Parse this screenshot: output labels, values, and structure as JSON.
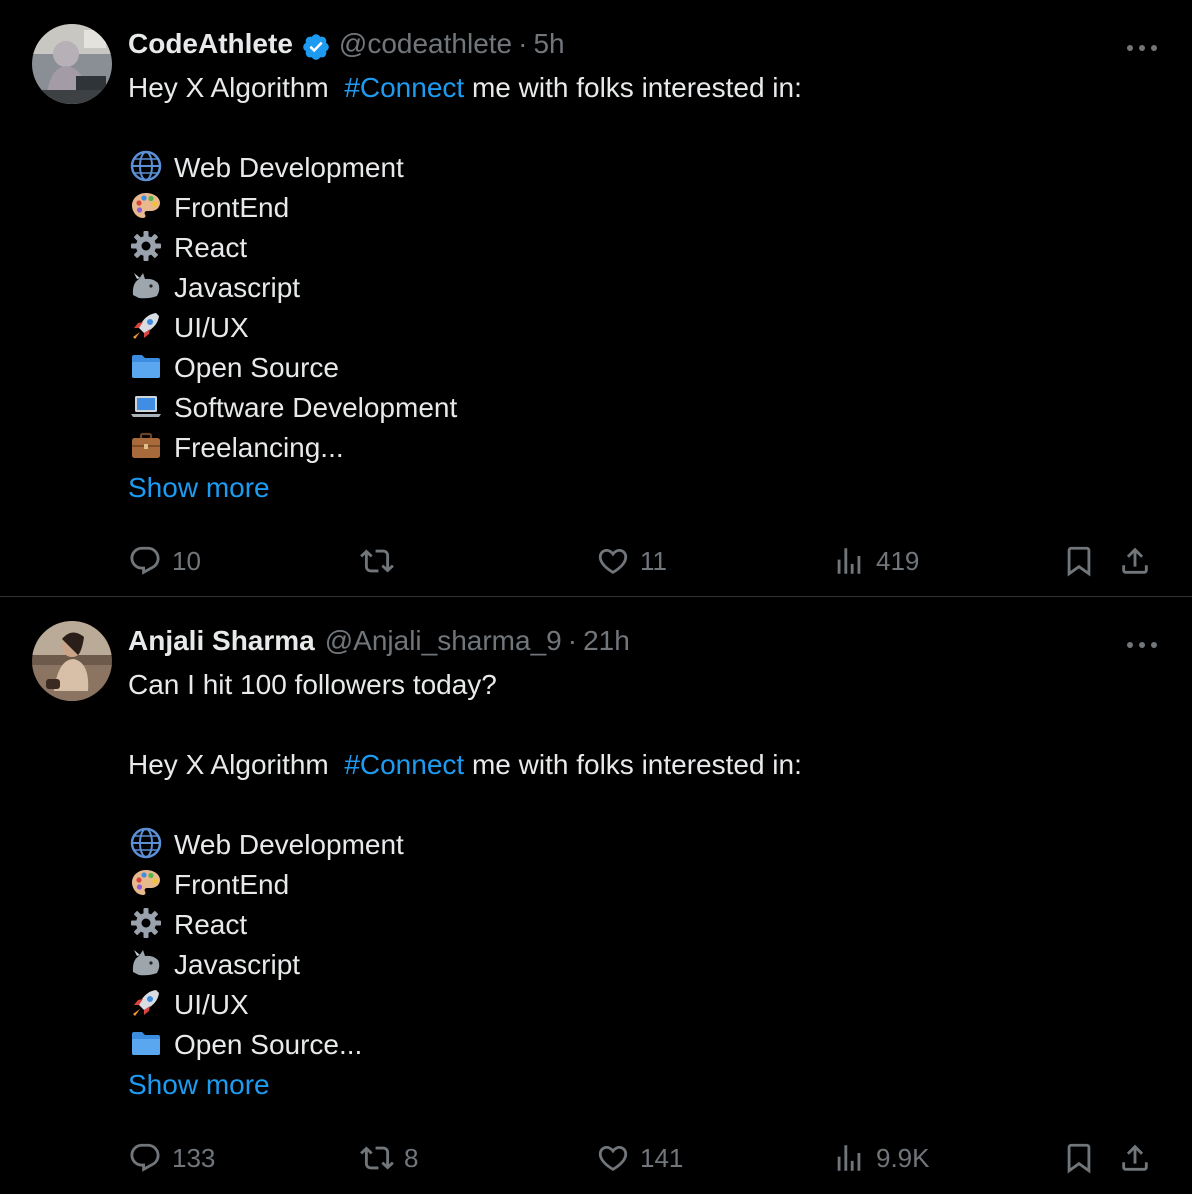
{
  "tweets": [
    {
      "name": "CodeAthlete",
      "handle": "@codeathlete",
      "separator": "·",
      "time": "5h",
      "verified": true,
      "lines": [
        {
          "type": "text",
          "parts": [
            {
              "t": "Hey X Algorithm  "
            },
            {
              "t": "#Connect",
              "tag": true
            },
            {
              "t": " me with folks interested in:"
            }
          ]
        },
        {
          "type": "blank"
        },
        {
          "type": "item",
          "icon": "globe-icon",
          "text": "Web Development"
        },
        {
          "type": "item",
          "icon": "palette-icon",
          "text": "FrontEnd"
        },
        {
          "type": "item",
          "icon": "gear-icon",
          "text": "React"
        },
        {
          "type": "item",
          "icon": "rhino-icon",
          "text": "Javascript"
        },
        {
          "type": "item",
          "icon": "rocket-icon",
          "text": "UI/UX"
        },
        {
          "type": "item",
          "icon": "folder-icon",
          "text": "Open Source"
        },
        {
          "type": "item",
          "icon": "laptop-icon",
          "text": "Software Development"
        },
        {
          "type": "item",
          "icon": "briefcase-icon",
          "text": "Freelancing..."
        }
      ],
      "show_more": "Show more",
      "replies": "10",
      "reposts": "",
      "likes": "11",
      "views": "419"
    },
    {
      "name": "Anjali Sharma",
      "handle": "@Anjali_sharma_9",
      "separator": "·",
      "time": "21h",
      "verified": false,
      "lines": [
        {
          "type": "text",
          "parts": [
            {
              "t": "Can I hit 100 followers today?"
            }
          ]
        },
        {
          "type": "blank"
        },
        {
          "type": "text",
          "parts": [
            {
              "t": "Hey X Algorithm  "
            },
            {
              "t": "#Connect",
              "tag": true
            },
            {
              "t": " me with folks interested in:"
            }
          ]
        },
        {
          "type": "blank"
        },
        {
          "type": "item",
          "icon": "globe-icon",
          "text": "Web Development"
        },
        {
          "type": "item",
          "icon": "palette-icon",
          "text": "FrontEnd"
        },
        {
          "type": "item",
          "icon": "gear-icon",
          "text": "React"
        },
        {
          "type": "item",
          "icon": "rhino-icon",
          "text": "Javascript"
        },
        {
          "type": "item",
          "icon": "rocket-icon",
          "text": "UI/UX"
        },
        {
          "type": "item",
          "icon": "folder-icon",
          "text": "Open Source..."
        }
      ],
      "show_more": "Show more",
      "replies": "133",
      "reposts": "8",
      "likes": "141",
      "views": "9.9K"
    }
  ],
  "colors": {
    "background": "#000000",
    "text": "#e7e9ea",
    "muted": "#71767b",
    "link": "#1d9bf0",
    "divider": "#2f3336"
  }
}
